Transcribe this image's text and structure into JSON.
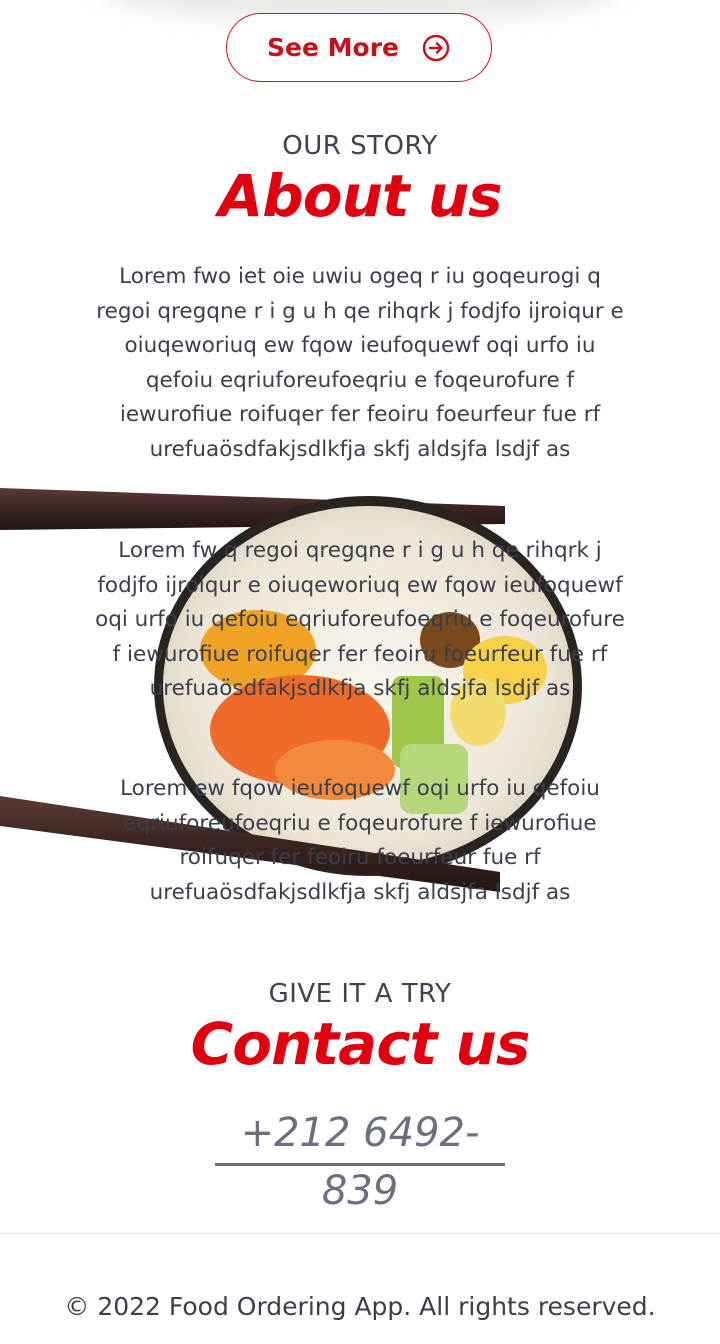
{
  "see_more": {
    "label": "See More",
    "icon": "arrow-circle-right-icon"
  },
  "about": {
    "eyebrow": "OUR STORY",
    "title": "About us",
    "paragraphs": [
      "Lorem fwo iet oie uwiu ogeq r iu goqeurogi q regoi qregqne r i g u h qe rihqrk j fodjfo ijroiqur e oiuqeworiuq ew fqow ieufoquewf oqi urfo iu qefoiu eqriuforeufoeqriu e foqeurofure f iewurofiue roifuqer fer feoiru foeurfeur fue rf urefuaösdfakjsdlkfja skfj aldsjfa lsdjf as",
      "Lorem fw q regoi qregqne r i g u h qe rihqrk j fodjfo ijroiqur e oiuqeworiuq ew fqow ieufoquewf oqi urfo iu qefoiu eqriuforeufoeqriu e foqeurofure f iewurofiue roifuqer fer feoiru foeurfeur fue rf urefuaösdfakjsdlkfja skfj aldsjfa lsdjf as",
      "Lorem ew fqow ieufoquewf oqi urfo iu qefoiu eqriuforeufoeqriu e foqeurofure f iewurofiue roifuqer fer feoiru foeurfeur fue rf urefuaösdfakjsdlkfja skfj aldsjfa lsdjf as"
    ]
  },
  "contact": {
    "eyebrow": "GIVE IT A TRY",
    "title": "Contact us",
    "phone": "+212 6492-839"
  },
  "footer": {
    "text": "© 2022 Food Ordering App. All rights reserved."
  },
  "colors": {
    "accent": "#e0000e",
    "text": "#3a3f4b",
    "muted": "#6b7080"
  }
}
